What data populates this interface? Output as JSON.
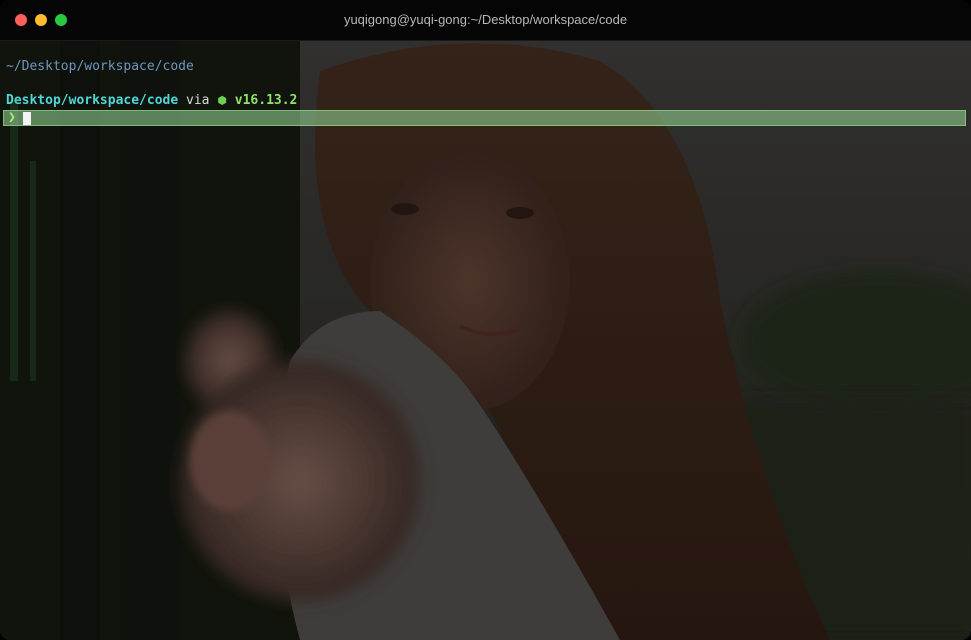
{
  "window": {
    "title": "yuqigong@yuqi-gong:~/Desktop/workspace/code"
  },
  "terminal": {
    "cwd_line": "~/Desktop/workspace/code",
    "prompt": {
      "directory": "Desktop/workspace/code",
      "via": " via ",
      "node_icon": "⬢",
      "node_version": "v16.13.2"
    },
    "input": {
      "chevron": "❯",
      "value": ""
    }
  },
  "colors": {
    "cwd": "#6f96c0",
    "directory": "#4fd6d6",
    "node_version": "#8fe36c",
    "input_highlight": "#8cc88c"
  }
}
